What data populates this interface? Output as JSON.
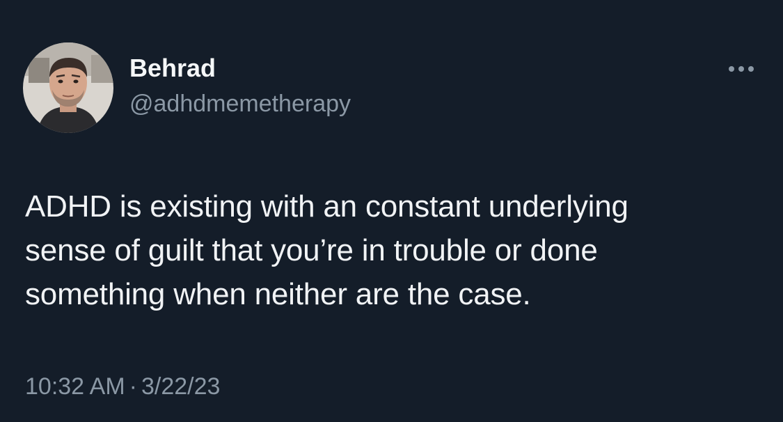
{
  "author": {
    "display_name": "Behrad",
    "handle": "@adhdmemetherapy",
    "avatar_icon": "user-avatar-photo"
  },
  "menu": {
    "icon": "more-options-icon"
  },
  "tweet": {
    "text": "ADHD is existing with an constant underlying\nsense of guilt that you’re in trouble or done\nsomething when neither are the case.",
    "time": "10:32 AM",
    "separator": "·",
    "date": "3/22/23"
  },
  "colors": {
    "background": "#141d29",
    "primary_text": "#f1f3f5",
    "secondary_text": "#8b98a5"
  }
}
